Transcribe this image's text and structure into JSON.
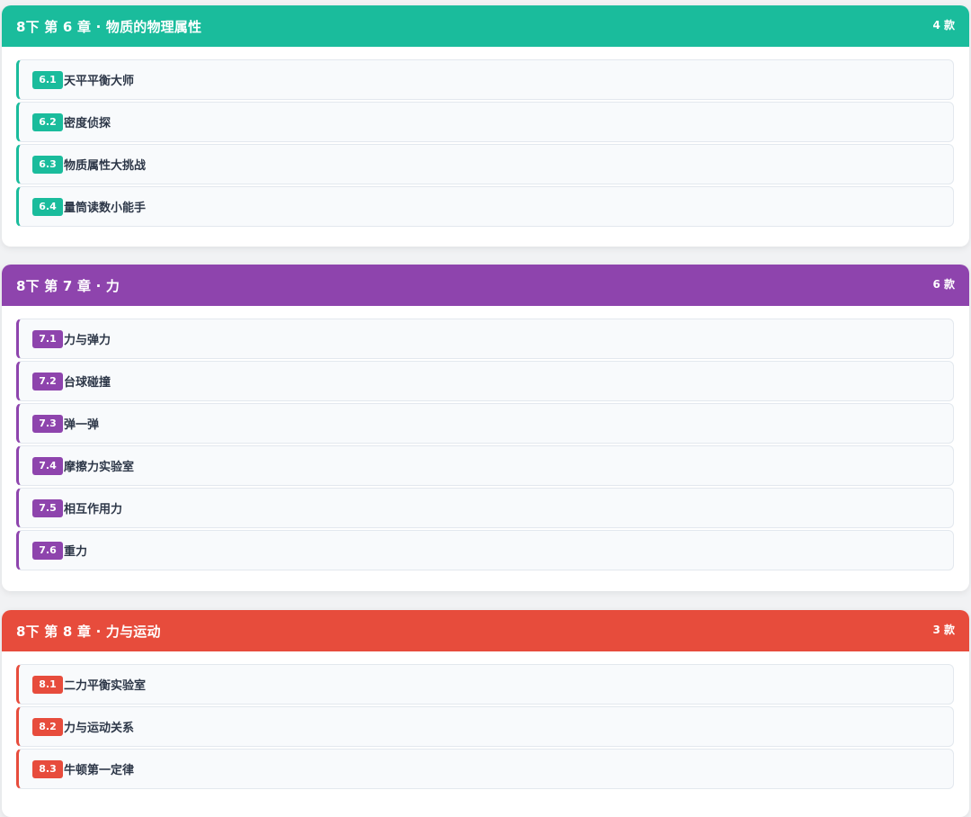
{
  "chapters": [
    {
      "title": "8下 第 6 章 · 物质的物理属性",
      "count": "4 款",
      "color": "#1abc9c",
      "items": [
        {
          "num": "6.1",
          "label": "天平平衡大师"
        },
        {
          "num": "6.2",
          "label": "密度侦探"
        },
        {
          "num": "6.3",
          "label": "物质属性大挑战"
        },
        {
          "num": "6.4",
          "label": "量筒读数小能手"
        }
      ]
    },
    {
      "title": "8下 第 7 章 · 力",
      "count": "6 款",
      "color": "#8e44ad",
      "items": [
        {
          "num": "7.1",
          "label": "力与弹力"
        },
        {
          "num": "7.2",
          "label": "台球碰撞"
        },
        {
          "num": "7.3",
          "label": "弹一弹"
        },
        {
          "num": "7.4",
          "label": "摩擦力实验室"
        },
        {
          "num": "7.5",
          "label": "相互作用力"
        },
        {
          "num": "7.6",
          "label": "重力"
        }
      ]
    },
    {
      "title": "8下 第 8 章 · 力与运动",
      "count": "3 款",
      "color": "#e74c3c",
      "items": [
        {
          "num": "8.1",
          "label": "二力平衡实验室"
        },
        {
          "num": "8.2",
          "label": "力与运动关系"
        },
        {
          "num": "8.3",
          "label": "牛顿第一定律"
        }
      ]
    }
  ]
}
